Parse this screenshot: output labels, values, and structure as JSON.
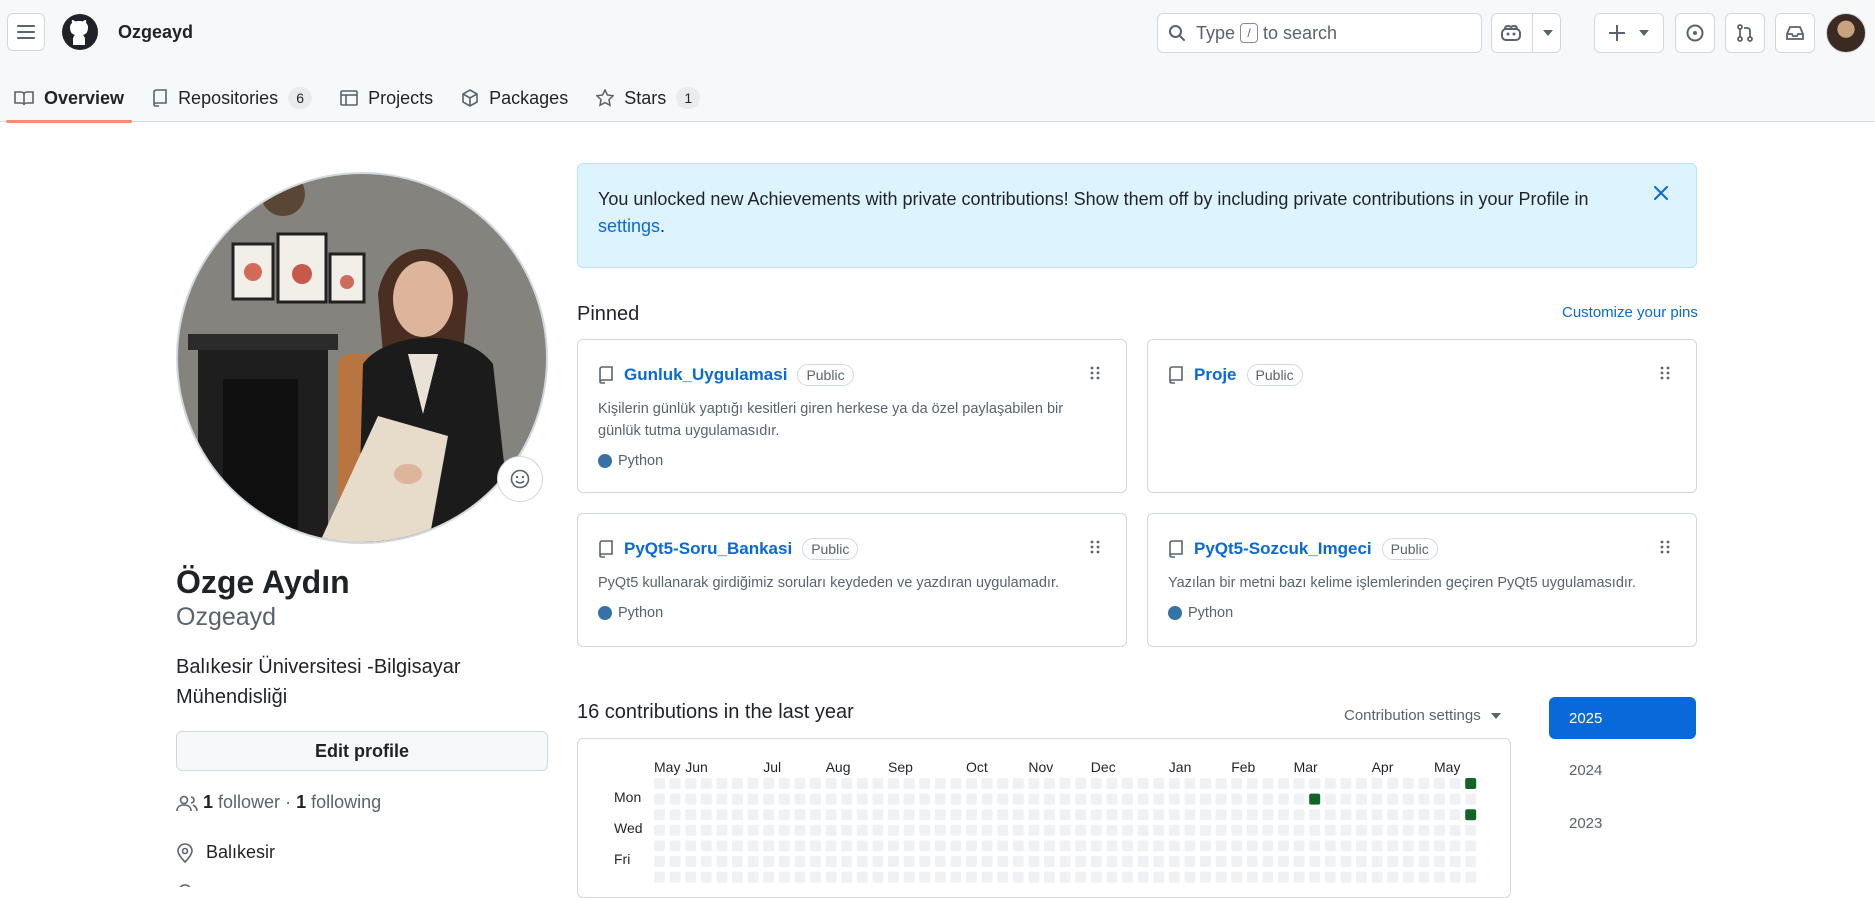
{
  "header": {
    "username": "Ozgeayd",
    "search": {
      "prefix": "Type",
      "key": "/",
      "suffix": "to search"
    }
  },
  "tabs": [
    {
      "label": "Overview",
      "icon": "book-icon",
      "active": true
    },
    {
      "label": "Repositories",
      "icon": "repo-icon",
      "count": "6"
    },
    {
      "label": "Projects",
      "icon": "table-icon"
    },
    {
      "label": "Packages",
      "icon": "package-icon"
    },
    {
      "label": "Stars",
      "icon": "star-icon",
      "count": "1"
    }
  ],
  "profile": {
    "full_name": "Özge Aydın",
    "login": "Ozgeayd",
    "bio": "Balıkesir Üniversitesi -Bilgisayar Mühendisliği",
    "edit_label": "Edit profile",
    "followers": "1",
    "followers_label": "follower",
    "separator": "·",
    "following": "1",
    "following_label": "following",
    "location": "Balıkesir"
  },
  "flash": {
    "text": "You unlocked new Achievements with private contributions! Show them off by including private contributions in your Profile in",
    "link": "settings",
    "end": "."
  },
  "pinned": {
    "heading": "Pinned",
    "customize": "Customize your pins",
    "repos": [
      {
        "name": "Gunluk_Uygulamasi",
        "visibility": "Public",
        "description": "Kişilerin günlük yaptığı kesitleri giren herkese ya da özel paylaşabilen bir günlük tutma uygulamasıdır.",
        "language": "Python"
      },
      {
        "name": "Proje",
        "visibility": "Public",
        "description": "",
        "language": ""
      },
      {
        "name": "PyQt5-Soru_Bankasi",
        "visibility": "Public",
        "description": "PyQt5 kullanarak girdiğimiz soruları keydeden ve yazdıran uygulamadır.",
        "language": "Python"
      },
      {
        "name": "PyQt5-Sozcuk_Imgeci",
        "visibility": "Public",
        "description": "Yazılan bir metni bazı kelime işlemlerinden geçiren PyQt5 uygulamasıdır.",
        "language": "Python"
      }
    ],
    "language_color": "#3572A5"
  },
  "contributions": {
    "heading": "16 contributions in the last year",
    "settings_label": "Contribution settings",
    "months": [
      "May",
      "Jun",
      "Jul",
      "Aug",
      "Sep",
      "Oct",
      "Nov",
      "Dec",
      "Jan",
      "Feb",
      "Mar",
      "Apr",
      "May"
    ],
    "days": [
      "Mon",
      "Wed",
      "Fri"
    ],
    "active_cells": [
      {
        "week": 42,
        "day": 1
      },
      {
        "week": 52,
        "day": 0
      },
      {
        "week": 52,
        "day": 2
      }
    ],
    "empty_color": "#eff2f5",
    "active_color": "#116329"
  },
  "years": [
    "2025",
    "2024",
    "2023"
  ],
  "selected_year": "2025"
}
